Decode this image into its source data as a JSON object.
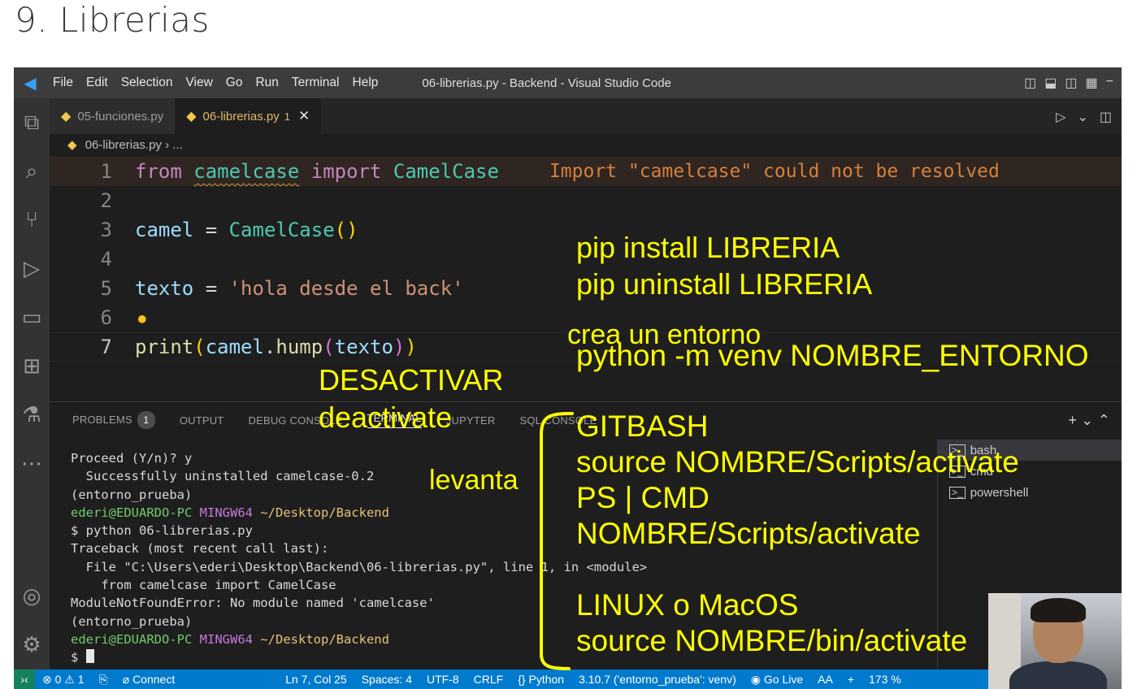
{
  "slide": {
    "title": "9. Librerias"
  },
  "titlebar": {
    "menu": [
      "File",
      "Edit",
      "Selection",
      "View",
      "Go",
      "Run",
      "Terminal",
      "Help"
    ],
    "window_title": "06-librerias.py - Backend - Visual Studio Code"
  },
  "tabs": [
    {
      "label": "05-funciones.py"
    },
    {
      "label": "06-librerias.py",
      "badge": "1",
      "close": "✕"
    }
  ],
  "breadcrumb": {
    "file": "06-librerias.py",
    "sep": "›",
    "rest": "..."
  },
  "editor": {
    "lines": [
      {
        "n": "1"
      },
      {
        "n": "2"
      },
      {
        "n": "3"
      },
      {
        "n": "4"
      },
      {
        "n": "5"
      },
      {
        "n": "6"
      },
      {
        "n": "7"
      }
    ],
    "code": {
      "l1_from": "from",
      "l1_mod": "camelcase",
      "l1_import": "import",
      "l1_cls": "CamelCase",
      "l1_diag": "Import \"camelcase\" could not be resolved",
      "l3_var": "camel",
      "l3_eq": "=",
      "l3_cls": "CamelCase",
      "l3_paren": "()",
      "l5_var": "texto",
      "l5_eq": "=",
      "l5_str": "'hola desde el back'",
      "l7_fn": "print",
      "l7_p1": "(",
      "l7_obj": "camel",
      "l7_dot": ".",
      "l7_m": "hump",
      "l7_p2": "(",
      "l7_arg": "texto",
      "l7_p3": ")",
      "l7_p4": ")"
    }
  },
  "panel": {
    "tabs": [
      "PROBLEMS",
      "OUTPUT",
      "DEBUG CONSOLE",
      "TERMINAL",
      "JUPYTER",
      "SQL CONSOLE"
    ],
    "problems_count": "1",
    "terminal": {
      "l1": "Proceed (Y/n)? y",
      "l2": "  Successfully uninstalled camelcase-0.2",
      "l3": "(entorno_prueba)",
      "l4_user": "ederi@EDUARDO-PC",
      "l4_env": "MINGW64",
      "l4_path": "~/Desktop/Backend",
      "l5": "$ python 06-librerias.py",
      "l6": "Traceback (most recent call last):",
      "l7": "  File \"C:\\Users\\ederi\\Desktop\\Backend\\06-librerias.py\", line 1, in <module>",
      "l8": "    from camelcase import CamelCase",
      "l9": "ModuleNotFoundError: No module named 'camelcase'",
      "l10": "(entorno_prueba)",
      "l11_user": "ederi@EDUARDO-PC",
      "l11_env": "MINGW64",
      "l11_path": "~/Desktop/Backend",
      "l12": "$ "
    },
    "terminal_list": [
      "bash",
      "cmd",
      "powershell"
    ]
  },
  "statusbar": {
    "errors": "⊗ 0",
    "warnings": "⚠ 1",
    "connect": "Connect",
    "position": "Ln 7, Col 25",
    "spaces": "Spaces: 4",
    "encoding": "UTF-8",
    "eol": "CRLF",
    "lang_braces": "{}",
    "language": "Python",
    "interpreter": "3.10.7 ('entorno_prueba': venv)",
    "golive": "Go Live",
    "font": "AA",
    "plus": "+",
    "zoom": "173 %"
  },
  "annotations": {
    "pip_install": "pip install LIBRERIA",
    "pip_uninstall": "pip uninstall LIBRERIA",
    "crea": "crea un entorno",
    "venv_cmd": "python -m venv NOMBRE_ENTORNO",
    "desactivar": "DESACTIVAR",
    "deactivate": "deactivate",
    "levanta": "levanta",
    "gitbash": "GITBASH",
    "gitbash_cmd": "source NOMBRE/Scripts/activate",
    "ps_cmd": "PS | CMD",
    "ps_cmd_path": "NOMBRE/Scripts/activate",
    "linux": "LINUX o MacOS",
    "linux_cmd": "source NOMBRE/bin/activate"
  },
  "colors": {
    "accent": "#007acc",
    "annotation": "#ffff00",
    "editor_bg": "#1e1e1e"
  }
}
